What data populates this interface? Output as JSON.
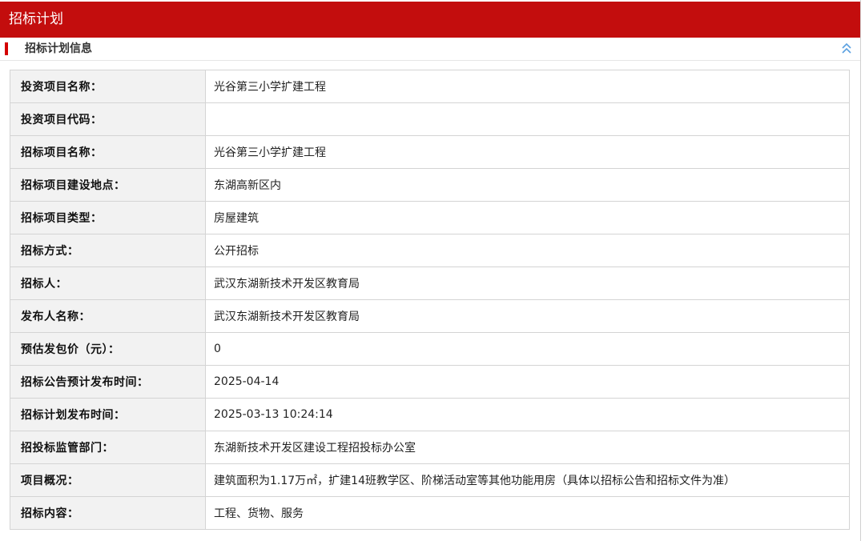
{
  "header": {
    "title": "招标计划"
  },
  "section": {
    "title": "招标计划信息",
    "collapse_icon": "double-chevron-up-icon",
    "accent_color": "#c30d0d"
  },
  "rows": [
    {
      "label": "投资项目名称：",
      "value": "光谷第三小学扩建工程"
    },
    {
      "label": "投资项目代码：",
      "value": ""
    },
    {
      "label": "招标项目名称：",
      "value": "光谷第三小学扩建工程"
    },
    {
      "label": "招标项目建设地点：",
      "value": "东湖高新区内"
    },
    {
      "label": "招标项目类型：",
      "value": "房屋建筑"
    },
    {
      "label": "招标方式：",
      "value": "公开招标"
    },
    {
      "label": "招标人：",
      "value": "武汉东湖新技术开发区教育局"
    },
    {
      "label": "发布人名称：",
      "value": "武汉东湖新技术开发区教育局"
    },
    {
      "label": "预估发包价（元）：",
      "value": "0"
    },
    {
      "label": "招标公告预计发布时间：",
      "value": "2025-04-14"
    },
    {
      "label": "招标计划发布时间：",
      "value": "2025-03-13 10:24:14"
    },
    {
      "label": "招投标监管部门：",
      "value": "东湖新技术开发区建设工程招投标办公室"
    },
    {
      "label": "项目概况：",
      "value": "建筑面积为1.17万㎡，扩建14班教学区、阶梯活动室等其他功能用房（具体以招标公告和招标文件为准）"
    },
    {
      "label": "招标内容：",
      "value": "工程、货物、服务"
    }
  ]
}
